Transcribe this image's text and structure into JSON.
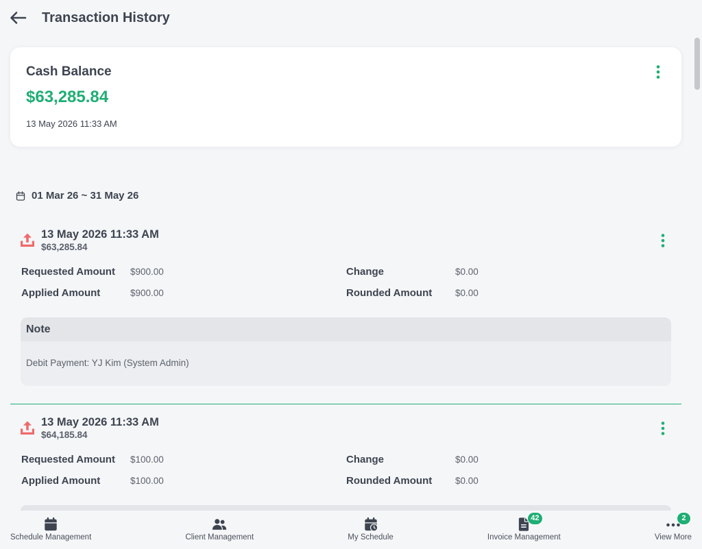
{
  "colors": {
    "accent": "#1fae74",
    "upload_icon": "#ef6b6b",
    "text_primary": "#3d4450",
    "background": "#f5f6f8"
  },
  "header": {
    "back_icon": "arrow-left-icon",
    "title": "Transaction History"
  },
  "balance_card": {
    "label": "Cash Balance",
    "amount": "$63,285.84",
    "timestamp": "13 May 2026 11:33 AM",
    "menu_icon": "kebab-menu-icon"
  },
  "filter": {
    "icon": "calendar-icon",
    "date_range": "01 Mar 26 ~ 31 May 26"
  },
  "field_labels": {
    "requested_amount": "Requested Amount",
    "applied_amount": "Applied Amount",
    "change": "Change",
    "rounded_amount": "Rounded Amount",
    "note": "Note"
  },
  "transactions": [
    {
      "icon": "upload-icon",
      "datetime": "13 May 2026 11:33 AM",
      "balance": "$63,285.84",
      "requested_amount": "$900.00",
      "applied_amount": "$900.00",
      "change": "$0.00",
      "rounded_amount": "$0.00",
      "note": "Debit Payment: YJ Kim (System Admin)"
    },
    {
      "icon": "upload-icon",
      "datetime": "13 May 2026 11:33 AM",
      "balance": "$64,185.84",
      "requested_amount": "$100.00",
      "applied_amount": "$100.00",
      "change": "$0.00",
      "rounded_amount": "$0.00"
    }
  ],
  "bottom_nav": {
    "items": [
      {
        "label": "Schedule Management",
        "icon": "calendar-icon"
      },
      {
        "label": "Client Management",
        "icon": "users-icon"
      },
      {
        "label": "My Schedule",
        "icon": "calendar-clock-icon"
      },
      {
        "label": "Invoice Management",
        "icon": "document-icon",
        "badge": "42"
      },
      {
        "label": "View More",
        "icon": "more-dots-icon",
        "badge": "2"
      }
    ]
  }
}
